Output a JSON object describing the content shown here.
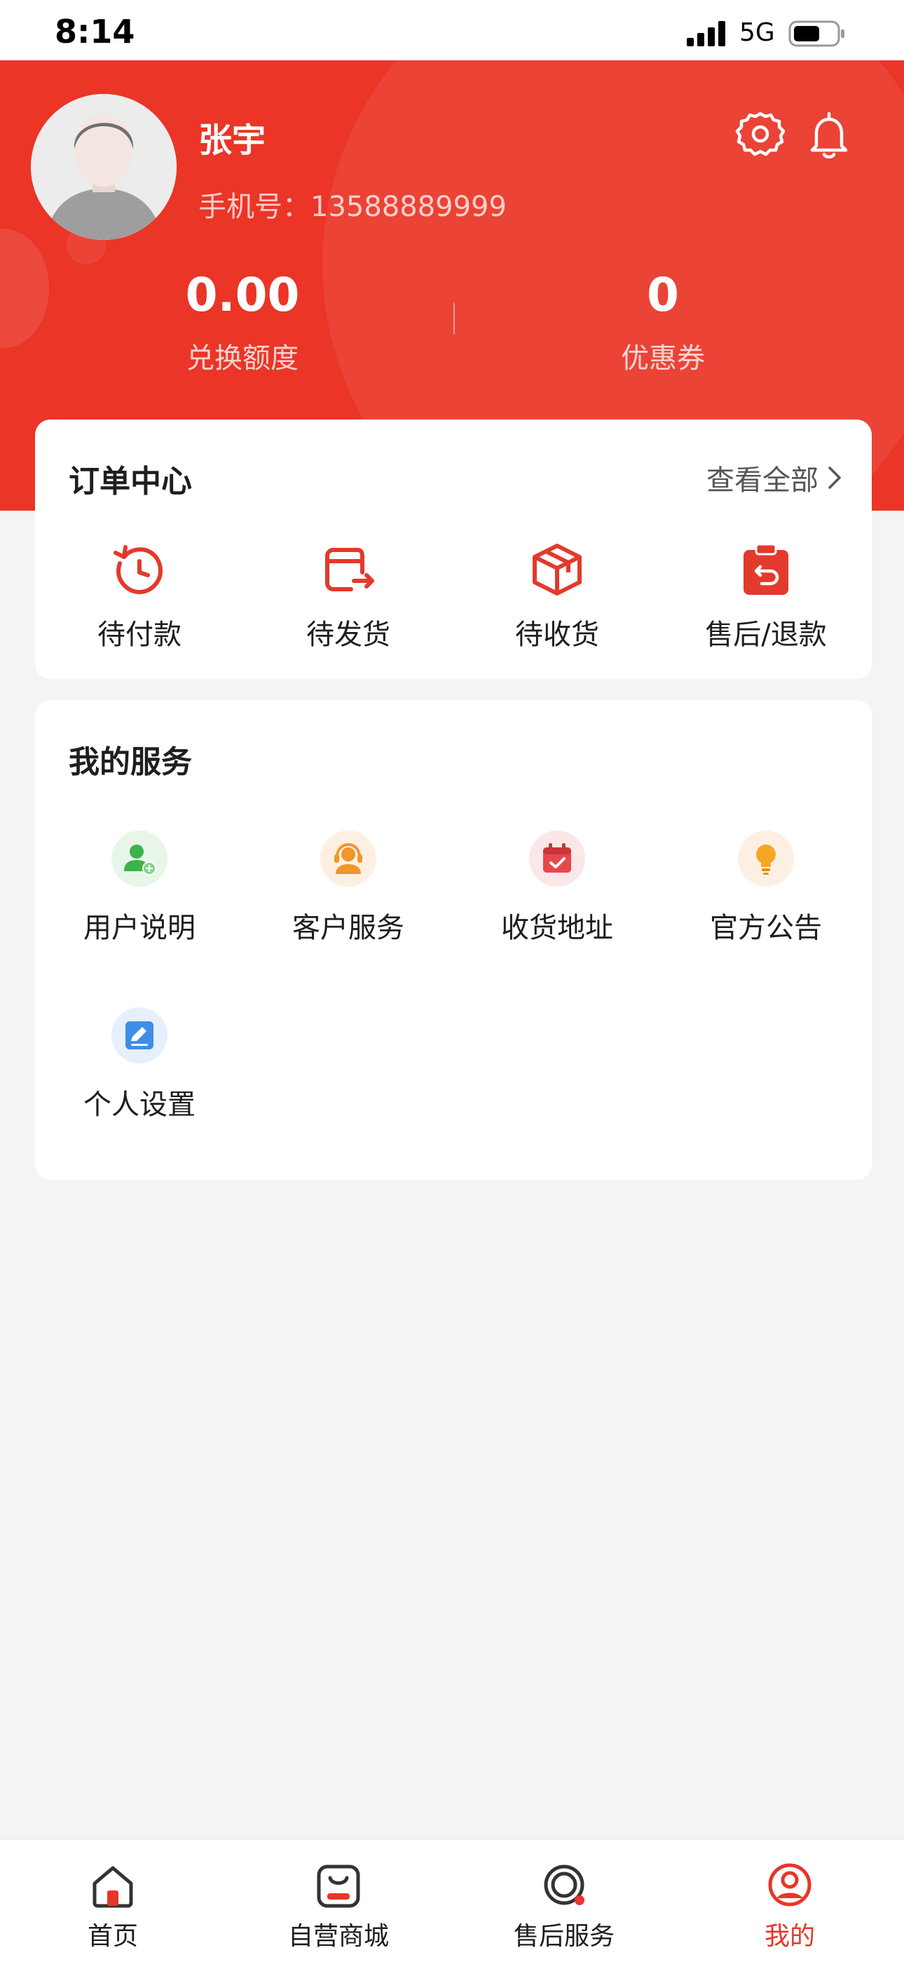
{
  "status_bar": {
    "time": "8:14",
    "network": "5G",
    "icons": [
      "signal-icon",
      "battery-icon"
    ]
  },
  "profile": {
    "name": "张宇",
    "phone_label": "手机号：",
    "phone": "13588889999",
    "icons": [
      "settings-icon",
      "bell-icon"
    ]
  },
  "stats": [
    {
      "value": "0.00",
      "label": "兑换额度"
    },
    {
      "value": "0",
      "label": "优惠券"
    }
  ],
  "order_center": {
    "title": "订单中心",
    "view_all": "查看全部",
    "items": [
      {
        "label": "待付款",
        "icon": "pending-payment-icon"
      },
      {
        "label": "待发货",
        "icon": "pending-shipment-icon"
      },
      {
        "label": "待收货",
        "icon": "pending-receipt-icon"
      },
      {
        "label": "售后/退款",
        "icon": "refund-icon"
      }
    ]
  },
  "services": {
    "title": "我的服务",
    "items": [
      {
        "label": "用户说明",
        "icon": "user-guide-icon"
      },
      {
        "label": "客户服务",
        "icon": "customer-service-icon"
      },
      {
        "label": "收货地址",
        "icon": "address-icon"
      },
      {
        "label": "官方公告",
        "icon": "announcement-icon"
      },
      {
        "label": "个人设置",
        "icon": "personal-settings-icon"
      }
    ]
  },
  "tabbar": {
    "active": "我的",
    "items": [
      {
        "label": "首页",
        "icon": "home-icon"
      },
      {
        "label": "自营商城",
        "icon": "mall-icon"
      },
      {
        "label": "售后服务",
        "icon": "after-sales-icon"
      },
      {
        "label": "我的",
        "icon": "profile-icon"
      }
    ]
  },
  "colors": {
    "brand_red": "#ea3527",
    "background": "#f4f4f4",
    "card": "#ffffff"
  }
}
